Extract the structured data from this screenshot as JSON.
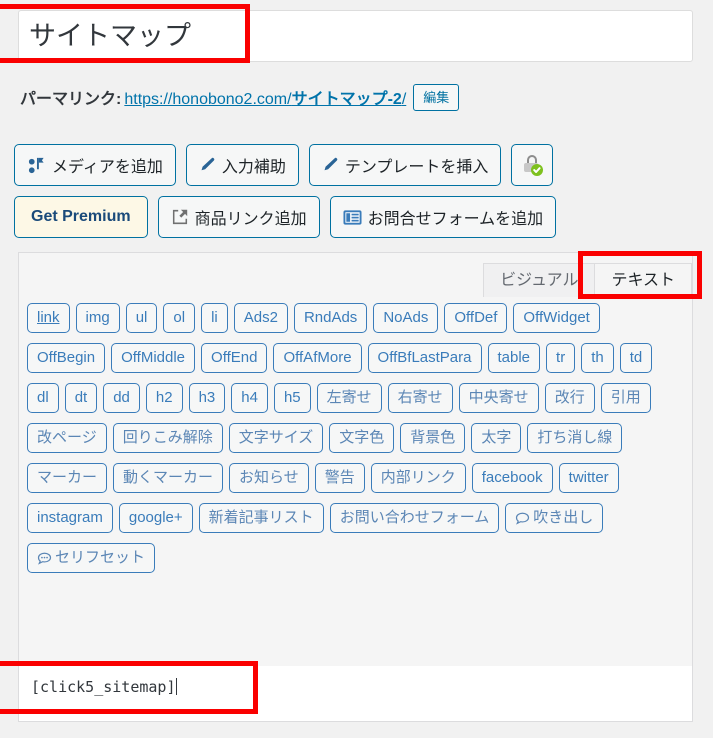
{
  "title": {
    "value": "サイトマップ"
  },
  "permalink": {
    "label": "パーマリンク:",
    "base_url": "https://honobono2.com/",
    "slug": "サイトマップ-2",
    "trailing": "/",
    "edit_label": "編集"
  },
  "media_toolbar": {
    "row1": [
      {
        "label": "メディアを追加",
        "icon": "media-add-icon",
        "style": "normal"
      },
      {
        "label": "入力補助",
        "icon": "pencil-icon",
        "style": "normal"
      },
      {
        "label": "テンプレートを挿入",
        "icon": "pencil-icon",
        "style": "normal"
      },
      {
        "label": "",
        "icon": "lock-verified-icon",
        "style": "square"
      }
    ],
    "row2": [
      {
        "label": "Get Premium",
        "icon": "",
        "style": "premium"
      },
      {
        "label": "商品リンク追加",
        "icon": "external-share-icon",
        "style": "normal"
      },
      {
        "label": "お問合せフォームを追加",
        "icon": "form-list-icon",
        "style": "normal"
      }
    ]
  },
  "editor": {
    "tabs": [
      {
        "label": "ビジュアル",
        "active": false
      },
      {
        "label": "テキスト",
        "active": true
      }
    ],
    "quicktags": [
      {
        "label": "link",
        "underline": true
      },
      {
        "label": "img"
      },
      {
        "label": "ul"
      },
      {
        "label": "ol"
      },
      {
        "label": "li"
      },
      {
        "label": "Ads2"
      },
      {
        "label": "RndAds"
      },
      {
        "label": "NoAds"
      },
      {
        "label": "OffDef"
      },
      {
        "label": "OffWidget"
      },
      {
        "label": "OffBegin"
      },
      {
        "label": "OffMiddle"
      },
      {
        "label": "OffEnd"
      },
      {
        "label": "OffAfMore"
      },
      {
        "label": "OffBfLastPara"
      },
      {
        "label": "table"
      },
      {
        "label": "tr"
      },
      {
        "label": "th"
      },
      {
        "label": "td"
      },
      {
        "label": "dl"
      },
      {
        "label": "dt"
      },
      {
        "label": "dd"
      },
      {
        "label": "h2"
      },
      {
        "label": "h3"
      },
      {
        "label": "h4"
      },
      {
        "label": "h5"
      },
      {
        "label": "左寄せ",
        "jp": true
      },
      {
        "label": "右寄せ",
        "jp": true
      },
      {
        "label": "中央寄せ",
        "jp": true
      },
      {
        "label": "改行",
        "jp": true
      },
      {
        "label": "引用",
        "jp": true
      },
      {
        "label": "改ページ",
        "jp": true
      },
      {
        "label": "回りこみ解除",
        "jp": true
      },
      {
        "label": "文字サイズ",
        "jp": true
      },
      {
        "label": "文字色",
        "jp": true
      },
      {
        "label": "背景色",
        "jp": true
      },
      {
        "label": "太字",
        "jp": true
      },
      {
        "label": "打ち消し線",
        "jp": true
      },
      {
        "label": "マーカー",
        "jp": true
      },
      {
        "label": "動くマーカー",
        "jp": true
      },
      {
        "label": "お知らせ",
        "jp": true
      },
      {
        "label": "警告",
        "jp": true
      },
      {
        "label": "内部リンク",
        "jp": true
      },
      {
        "label": "facebook"
      },
      {
        "label": "twitter"
      },
      {
        "label": "instagram"
      },
      {
        "label": "google+"
      },
      {
        "label": "新着記事リスト",
        "jp": true
      },
      {
        "label": "お問い合わせフォーム",
        "jp": true
      },
      {
        "label": "吹き出し",
        "jp": true,
        "icon": "speech-bubble-icon"
      },
      {
        "label": "セリフセット",
        "jp": true,
        "icon": "speech-bubbles-icon"
      }
    ],
    "content": "[click5_sitemap]"
  },
  "colors": {
    "highlight": "#fa0000",
    "link": "#0073aa",
    "quicktag_border": "#3a7cba",
    "premium_bg": "#fdf8e6"
  }
}
